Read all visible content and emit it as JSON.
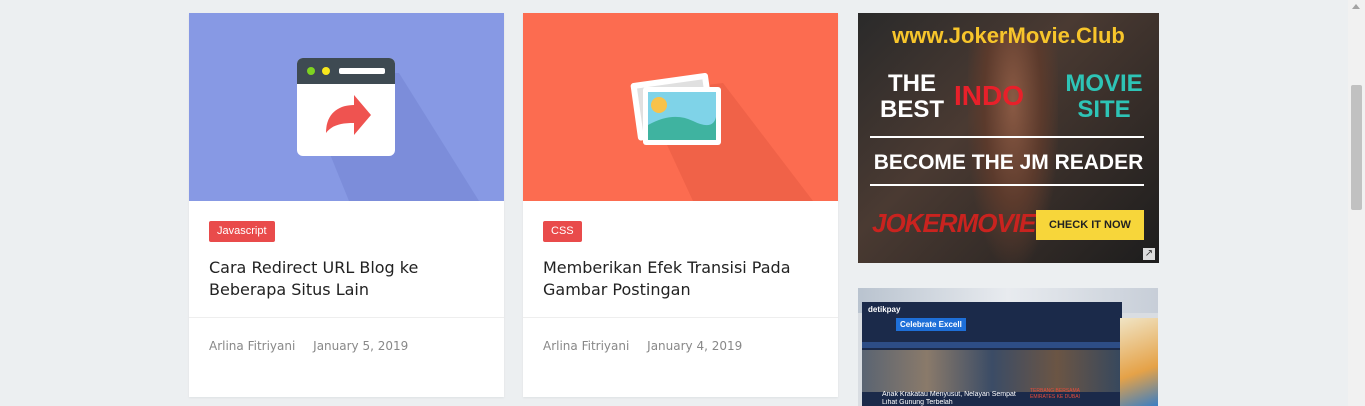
{
  "posts": [
    {
      "tag": "Javascript",
      "title": "Cara Redirect URL Blog ke Beberapa Situs Lain",
      "author": "Arlina Fitriyani",
      "date": "January 5, 2019",
      "bg": "#8799e4"
    },
    {
      "tag": "CSS",
      "title": "Memberikan Efek Transisi Pada Gambar Postingan",
      "author": "Arlina Fitriyani",
      "date": "January 4, 2019",
      "bg": "#fc6c50"
    }
  ],
  "ad1": {
    "url": "www.JokerMovie.Club",
    "the_best": "THE BEST",
    "indo": "INDO",
    "movie_site": "MOVIE SITE",
    "become": "BECOME THE JM READER",
    "brand": "JOKERMOVIE",
    "cta": "CHECK IT NOW"
  },
  "ad2": {
    "brand": "detikpay",
    "promo": "Celebrate Excell",
    "headline1": "Anak Krakatau Menyusut, Nelayan Sempat",
    "headline2": "Lihat Gunung Terbelah",
    "side": "TERBANG BERSAMA EMIRATES KE DUBAI"
  },
  "colors": {
    "tag": "#e94b4b",
    "accent_yellow": "#f7d63a",
    "indo_red": "#e8202a",
    "movie_teal": "#2ec4b6"
  }
}
